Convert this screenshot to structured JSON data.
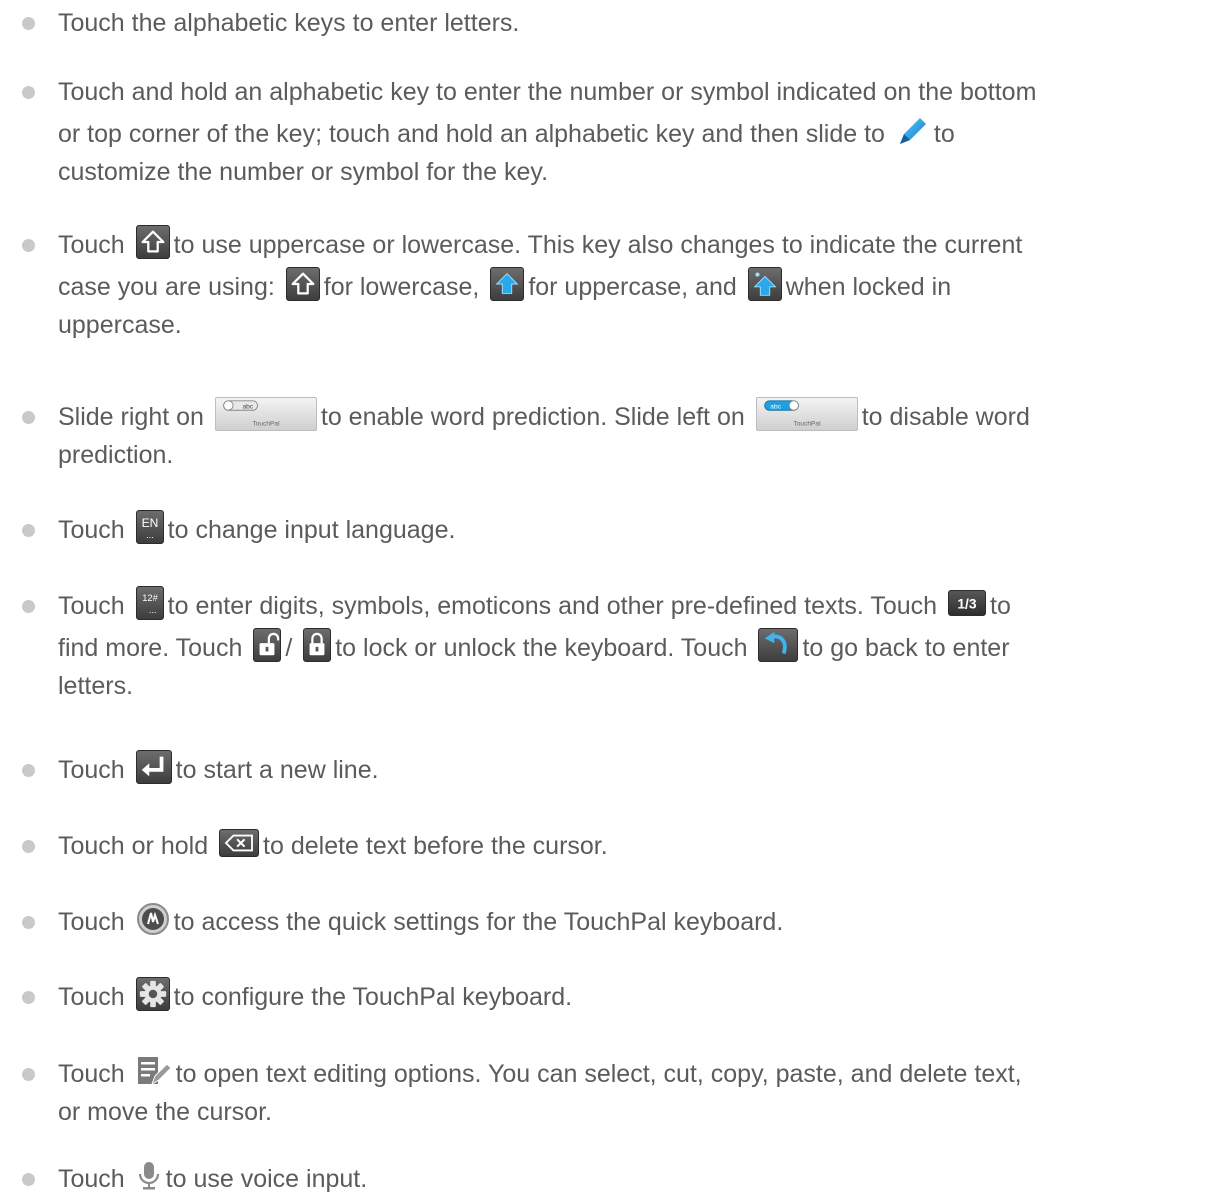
{
  "items": [
    {
      "lines": [
        [
          "Touch the alphabetic keys to enter letters."
        ]
      ]
    },
    {
      "lines": [
        [
          "Touch and hold an alphabetic key to enter the number or symbol indicated on the bottom"
        ],
        [
          "or top corner of the key; touch and hold an alphabetic key and then slide to ",
          "to"
        ],
        [
          "customize the number or symbol for the key."
        ]
      ]
    },
    {
      "lines": [
        [
          "Touch ",
          "to use uppercase or lowercase. This key also changes to indicate the current"
        ],
        [
          "case you are using: ",
          "for lowercase, ",
          "for uppercase, and ",
          "when locked in"
        ],
        [
          "uppercase."
        ]
      ]
    },
    {
      "lines": [
        [
          "Slide right on ",
          "to enable word prediction. Slide left on ",
          "to disable word"
        ],
        [
          "prediction."
        ]
      ]
    },
    {
      "lines": [
        [
          "Touch ",
          "to change input language."
        ]
      ]
    },
    {
      "lines": [
        [
          "Touch ",
          "to enter digits, symbols, emoticons and other pre-defined texts. Touch ",
          "to"
        ],
        [
          "find more. Touch ",
          "/ ",
          "to lock or unlock the keyboard. Touch ",
          "to go back to enter"
        ],
        [
          "letters."
        ]
      ]
    },
    {
      "lines": [
        [
          "Touch ",
          "to start a new line."
        ]
      ]
    },
    {
      "lines": [
        [
          "Touch or hold ",
          "to delete text before the cursor."
        ]
      ]
    },
    {
      "lines": [
        [
          "Touch ",
          "to access the quick settings for the TouchPal keyboard."
        ]
      ]
    },
    {
      "lines": [
        [
          "Touch ",
          "to configure the TouchPal keyboard."
        ]
      ]
    },
    {
      "lines": [
        [
          "Touch ",
          "to open text editing options. You can select, cut, copy, paste, and delete text,"
        ],
        [
          "or move the cursor."
        ]
      ]
    },
    {
      "lines": [
        [
          "Touch ",
          "to use voice input."
        ]
      ]
    }
  ],
  "icon_labels": {
    "toggle_text": "abc",
    "toggle_brand": "TouchPal",
    "language_key": "EN",
    "symbol_key": "12#",
    "page_key": "1/3"
  },
  "icons": {
    "pencil": "pencil-icon",
    "shift": "shift-icon",
    "shift_up": "shift-uppercase-icon",
    "shift_lock": "shift-locked-icon",
    "toggle_off": "word-prediction-off-toggle-icon",
    "toggle_on": "word-prediction-on-toggle-icon",
    "language": "language-key-icon",
    "symbols": "symbols-key-icon",
    "page": "page-indicator-icon",
    "unlock": "unlock-icon",
    "lock": "lock-icon",
    "back": "back-arrow-icon",
    "enter": "enter-key-icon",
    "delete": "delete-key-icon",
    "quick_settings": "quick-settings-icon",
    "settings": "gear-icon",
    "text_edit": "text-edit-icon",
    "voice": "microphone-icon"
  },
  "colors": {
    "text": "#5b5b5b",
    "bullet": "#c9c9c9",
    "accent_blue": "#1e9fe0"
  }
}
